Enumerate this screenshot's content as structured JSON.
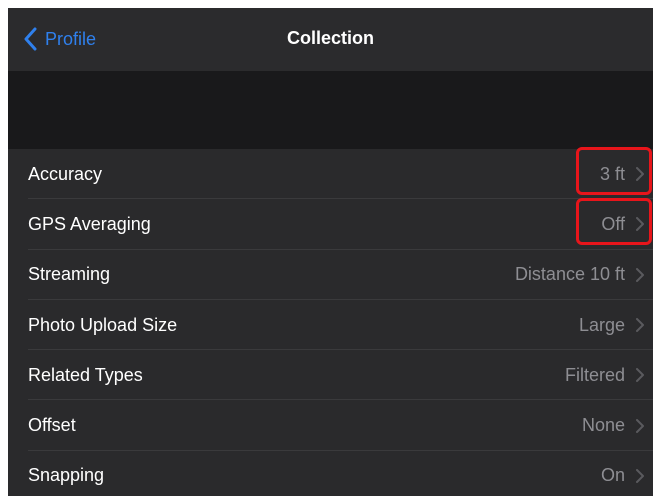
{
  "navbar": {
    "back_label": "Profile",
    "title": "Collection"
  },
  "settings": {
    "rows": [
      {
        "label": "Accuracy",
        "value": "3 ft"
      },
      {
        "label": "GPS Averaging",
        "value": "Off"
      },
      {
        "label": "Streaming",
        "value": "Distance 10 ft"
      },
      {
        "label": "Photo Upload Size",
        "value": "Large"
      },
      {
        "label": "Related Types",
        "value": "Filtered"
      },
      {
        "label": "Offset",
        "value": "None"
      },
      {
        "label": "Snapping",
        "value": "On"
      }
    ]
  },
  "colors": {
    "accent": "#2f80ed",
    "highlight": "#e8151b",
    "row_background": "#2a2a2c",
    "value_text": "#8e8e93"
  },
  "icons": {
    "back": "chevron-left-icon",
    "disclosure": "chevron-right-icon"
  }
}
